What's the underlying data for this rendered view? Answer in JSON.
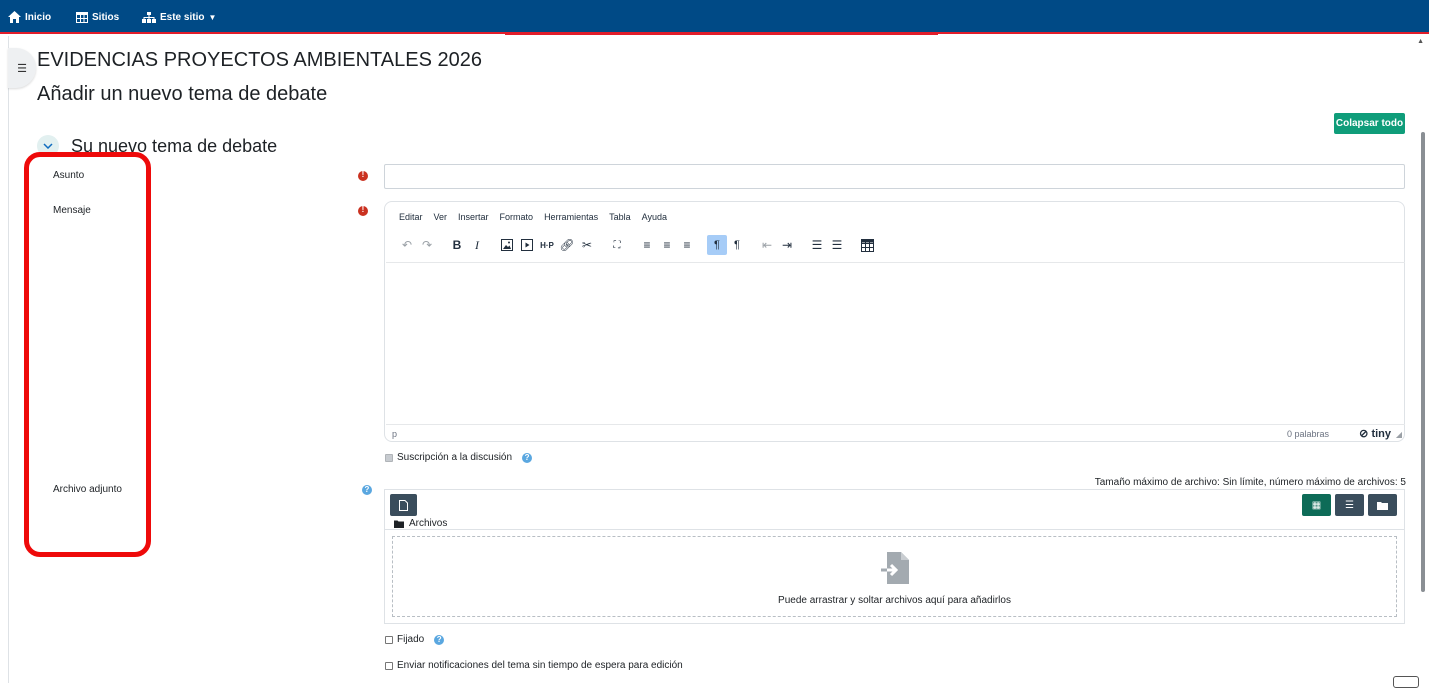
{
  "nav": {
    "home": "Inicio",
    "sites": "Sitios",
    "this_site": "Este sitio"
  },
  "page": {
    "course_title": "EVIDENCIAS PROYECTOS AMBIENTALES 2026",
    "form_title": "Añadir un nuevo tema de debate",
    "collapse_all": "Colapsar todo",
    "section_title": "Su nuevo tema de debate"
  },
  "form": {
    "subject_label": "Asunto",
    "subject_value": "",
    "message_label": "Mensaje",
    "attachment_label": "Archivo adjunto",
    "subscription_label": "Suscripción a la discusión",
    "pinned_label": "Fijado",
    "notify_label": "Enviar notificaciones del tema sin tiempo de espera para edición"
  },
  "editor": {
    "menu": [
      "Editar",
      "Ver",
      "Insertar",
      "Formato",
      "Herramientas",
      "Tabla",
      "Ayuda"
    ],
    "status_path": "p",
    "word_count": "0 palabras",
    "brand": "tiny"
  },
  "filemanager": {
    "max_size": "Tamaño máximo de archivo: Sin límite, número máximo de archivos: 5",
    "folder": "Archivos",
    "drop_text": "Puede arrastrar y soltar archivos aquí para añadirlos"
  },
  "colors": {
    "navbar": "#004a86",
    "accent_red": "#e11d2a",
    "collapse_button": "#0f9d7a",
    "required": "#ca3120",
    "annotation": "#ee0a0a"
  }
}
